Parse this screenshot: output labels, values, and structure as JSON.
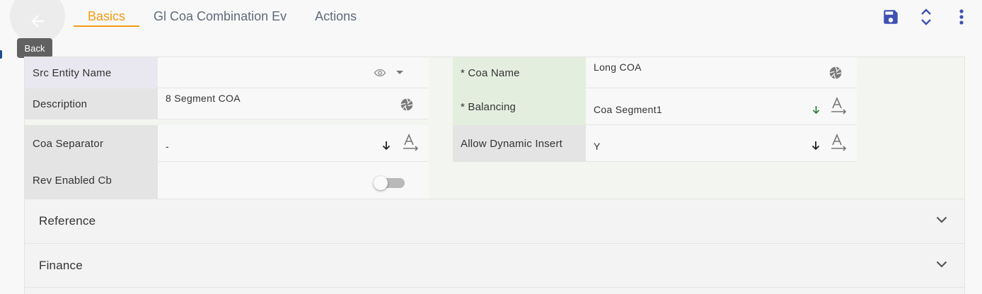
{
  "nav": {
    "back_tooltip": "Back",
    "tabs": [
      {
        "label": "Basics",
        "active": true
      },
      {
        "label": "Gl Coa Combination Ev",
        "active": false
      },
      {
        "label": "Actions",
        "active": false
      }
    ]
  },
  "toolbar": {
    "save_icon": "save-icon",
    "expand_icon": "unfold-icon",
    "more_icon": "more-vert-icon",
    "save_color": "#3f51b5"
  },
  "form": {
    "src_entity_name": {
      "label": "Src Entity Name",
      "value": ""
    },
    "description": {
      "label": "Description",
      "value": "8 Segment COA"
    },
    "coa_separator": {
      "label": "Coa Separator",
      "value": "-"
    },
    "rev_enabled_cb": {
      "label": "Rev Enabled Cb",
      "checked": false
    },
    "coa_name": {
      "label": "* Coa Name",
      "value": "Long COA"
    },
    "balancing": {
      "label": "* Balancing",
      "value": "Coa Segment1"
    },
    "allow_dynamic_insert": {
      "label": "Allow Dynamic Insert",
      "value": "Y"
    }
  },
  "sections": [
    {
      "title": "Reference"
    },
    {
      "title": "Finance"
    }
  ],
  "colors": {
    "accent": "#f29b11",
    "tab_text": "#5f6b7a",
    "save_icon": "#3f51b5",
    "balancing_arrow": "#2e7d32"
  }
}
